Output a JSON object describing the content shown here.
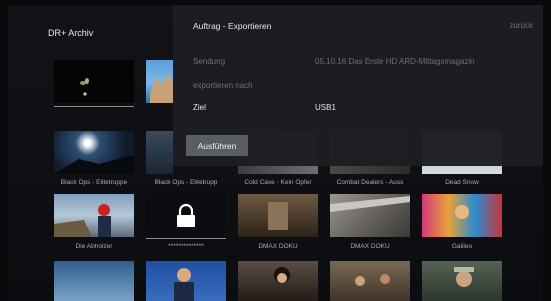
{
  "header": {
    "title": "DR+ Archiv"
  },
  "dialog": {
    "title": "Auftrag - Exportieren",
    "back_label": "zurück",
    "rows": [
      {
        "label": "Sendung",
        "value": "05.10.16 Das Erste HD ARD-Mittagsmagazin"
      },
      {
        "label": "exportieren nach",
        "value": ""
      },
      {
        "label": "Ziel",
        "value": "USB1"
      }
    ],
    "run_label": "Ausführen"
  },
  "grid": {
    "row2_labels": [
      "Black Ops - Elitetruppe",
      "Black Ops - Elitetrupp",
      "Cold Case - Kein Opfer",
      "Combat Dealers - Auss",
      "Dead Snow"
    ],
    "row3_labels": [
      "Die Abholzer",
      "**************",
      "DMAX DOKU",
      "DMAX DOKU",
      "Galileo"
    ]
  },
  "colors": {
    "accent": "#5a5d63",
    "dialog_bg": "#1c1e22"
  }
}
